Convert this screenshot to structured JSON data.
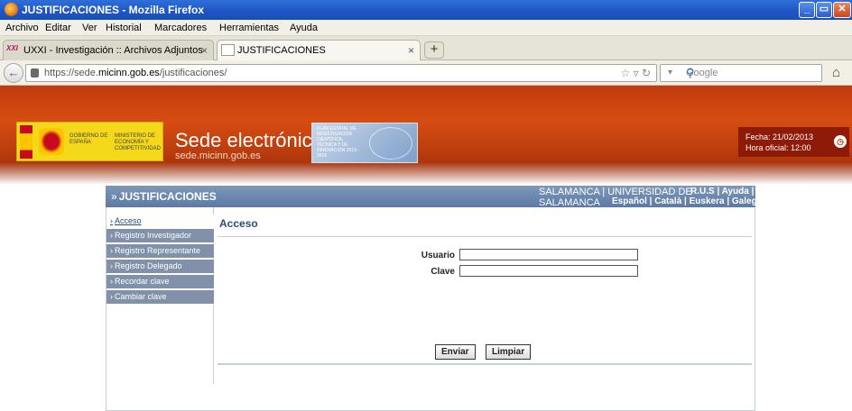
{
  "window": {
    "title": "JUSTIFICACIONES - Mozilla Firefox"
  },
  "menubar": [
    "Archivo",
    "Editar",
    "Ver",
    "Historial",
    "Marcadores",
    "Herramientas",
    "Ayuda"
  ],
  "tabs": [
    {
      "label": "UXXI - Investigación :: Archivos Adjuntos",
      "active": false
    },
    {
      "label": "JUSTIFICACIONES",
      "active": true
    }
  ],
  "nav": {
    "url_prefix": "https://sede.",
    "url_host": "micinn.gob.es",
    "url_path": "/justificaciones/",
    "search_placeholder": "Google"
  },
  "banner": {
    "gob_left": "GOBIERNO DE ESPAÑA",
    "gob_right": "MINISTERIO DE ECONOMÍA Y COMPETITIVIDAD",
    "sede_title": "Sede electrónica",
    "sede_url": "sede.micinn.gob.es",
    "plan_text": "PLAN ESTATAL DE INVESTIGACIÓN CIENTÍFICA, TÉCNICA Y DE INNOVACIÓN 2013-2016",
    "fecha": "Fecha: 21/02/2013",
    "hora": "Hora oficial: 12:00"
  },
  "app": {
    "title": "JUSTIFICACIONES",
    "organization": "SALAMANCA | UNIVERSIDAD DE SALAMANCA",
    "top_links": "R.U.S | Ayuda | F.A.Q",
    "languages": "Español | Català | Euskera | Galego"
  },
  "sidebar": {
    "items": [
      {
        "label": "Acceso",
        "active": true
      },
      {
        "label": "Registro Investigador",
        "active": false
      },
      {
        "label": "Registro Representante",
        "active": false
      },
      {
        "label": "Registro Delegado",
        "active": false
      },
      {
        "label": "Recordar clave",
        "active": false
      },
      {
        "label": "Cambiar clave",
        "active": false
      }
    ]
  },
  "form": {
    "heading": "Acceso",
    "usuario_label": "Usuario",
    "usuario_value": "",
    "clave_label": "Clave",
    "clave_value": "",
    "submit_label": "Enviar",
    "clear_label": "Limpiar"
  },
  "colors": {
    "banner": "#c33a0e",
    "app_header": "#6a85ac",
    "sidebar": "#8191a9"
  }
}
